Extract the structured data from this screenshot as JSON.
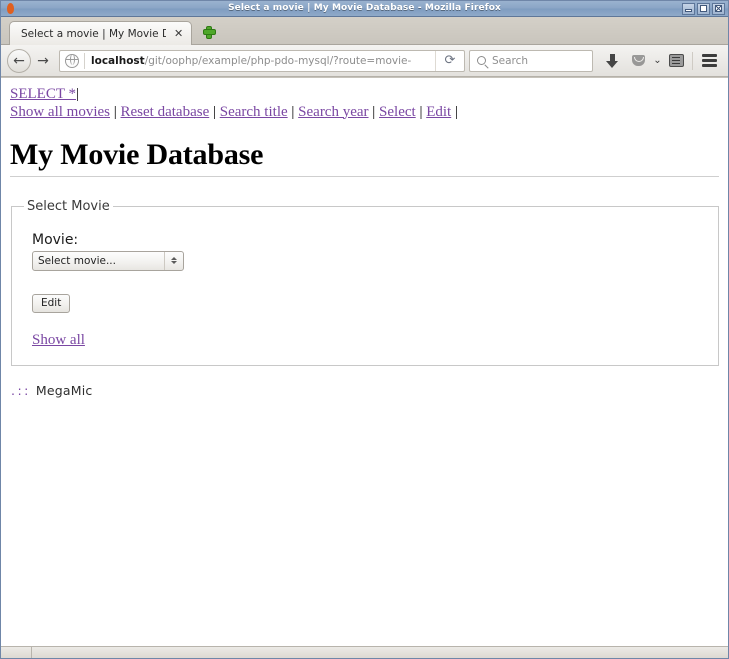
{
  "window": {
    "title": "Select a movie | My Movie Database - Mozilla Firefox",
    "app_icon": "firefox-icon",
    "controls": {
      "minimize": "minimize-button",
      "maximize": "maximize-button",
      "close": "close-button"
    }
  },
  "tabs": [
    {
      "title": "Select a movie | My Movie D...",
      "close_label": "✕"
    }
  ],
  "newtab": {
    "label": "+"
  },
  "toolbar": {
    "back_glyph": "←",
    "forward_glyph": "→",
    "reload_glyph": "⟳",
    "url": {
      "host": "localhost",
      "path": "/git/oophp/example/php-pdo-mysql/?route=movie-"
    },
    "search": {
      "placeholder": "Search"
    },
    "icons": [
      "download-icon",
      "pocket-icon",
      "chevron-down-icon",
      "reader-mode-icon",
      "menu-icon"
    ],
    "chevron_glyph": "⌄"
  },
  "page": {
    "nav_line1": [
      {
        "label": "SELECT *",
        "type": "link"
      },
      {
        "label": "|",
        "type": "separator"
      }
    ],
    "nav_line2": [
      {
        "label": "Show all movies",
        "type": "link"
      },
      {
        "label": "|",
        "type": "separator"
      },
      {
        "label": "Reset database",
        "type": "link"
      },
      {
        "label": "|",
        "type": "separator"
      },
      {
        "label": "Search title",
        "type": "link"
      },
      {
        "label": "|",
        "type": "separator"
      },
      {
        "label": "Search year",
        "type": "link"
      },
      {
        "label": "|",
        "type": "separator"
      },
      {
        "label": "Select",
        "type": "link"
      },
      {
        "label": "|",
        "type": "separator"
      },
      {
        "label": "Edit",
        "type": "link"
      },
      {
        "label": "|",
        "type": "separator"
      }
    ],
    "title": "My Movie Database",
    "fieldset": {
      "legend": "Select Movie",
      "movie_label": "Movie:",
      "select": {
        "value": "Select movie...",
        "options": [
          "Select movie..."
        ]
      },
      "submit_label": "Edit",
      "show_all_label": "Show all"
    },
    "footer": {
      "dots": ".::",
      "brand": "MegaMic"
    },
    "colors": {
      "link": "#7a47a3",
      "text": "#000000",
      "background": "#ffffff",
      "fieldset_border": "#c8c8c8"
    }
  }
}
